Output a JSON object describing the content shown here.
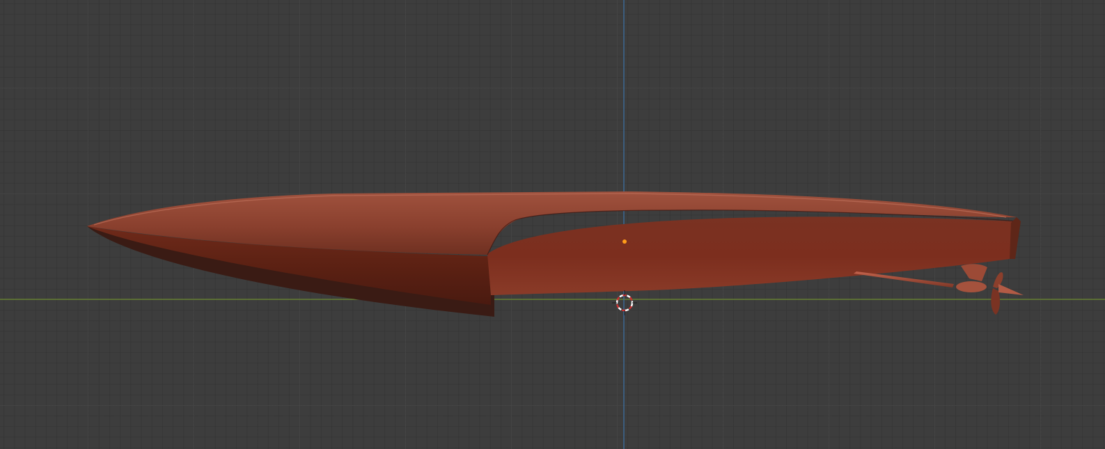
{
  "viewport": {
    "background_color": "#3d3d3d",
    "axis_x_color": "#6b8a2e",
    "axis_z_color": "#3d6fa0"
  },
  "object": {
    "kind": "boat-hull",
    "material_color": "#8f3f2e",
    "origin_color": "#ff9d1a"
  },
  "cursor": {
    "icon": "3d-cursor-icon",
    "ring_color_primary": "#ffffff",
    "ring_color_secondary": "#d03030"
  }
}
